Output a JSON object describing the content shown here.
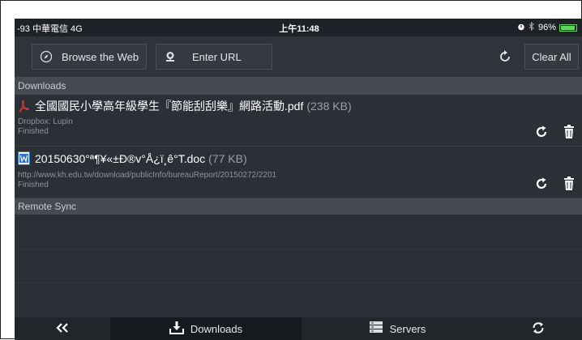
{
  "statusbar": {
    "carrier": "-93 中華電信 4G",
    "time": "上午11:48",
    "battery_text": "96%",
    "battery_level": 0.96
  },
  "toolbar": {
    "browse_label": "Browse the Web",
    "url_label": "Enter URL",
    "clear_label": "Clear All"
  },
  "sections": {
    "downloads": "Downloads",
    "remote_sync": "Remote Sync"
  },
  "downloads": [
    {
      "filename": "全國國民小學高年級學生『節能刮刮樂』網路活動.pdf",
      "size": "(238 KB)",
      "source": "Dropbox: Lupin",
      "status": "Finished",
      "icon": "pdf-icon"
    },
    {
      "filename": "20150630°ª¶¥«±Ð®v°Å¿ï¸ê°T.doc",
      "size": "(77 KB)",
      "source": "http://www.kh.edu.tw/download/publicInfo/bureauReport/20150272/2201",
      "status": "Finished",
      "icon": "word-icon"
    }
  ],
  "tabbar": {
    "downloads": "Downloads",
    "servers": "Servers"
  },
  "colors": {
    "background": "#2b3037",
    "section_header": "#464b52",
    "active_tab": "#16191d",
    "pdf_red": "#d9342b",
    "word_blue": "#2f6fd0"
  }
}
